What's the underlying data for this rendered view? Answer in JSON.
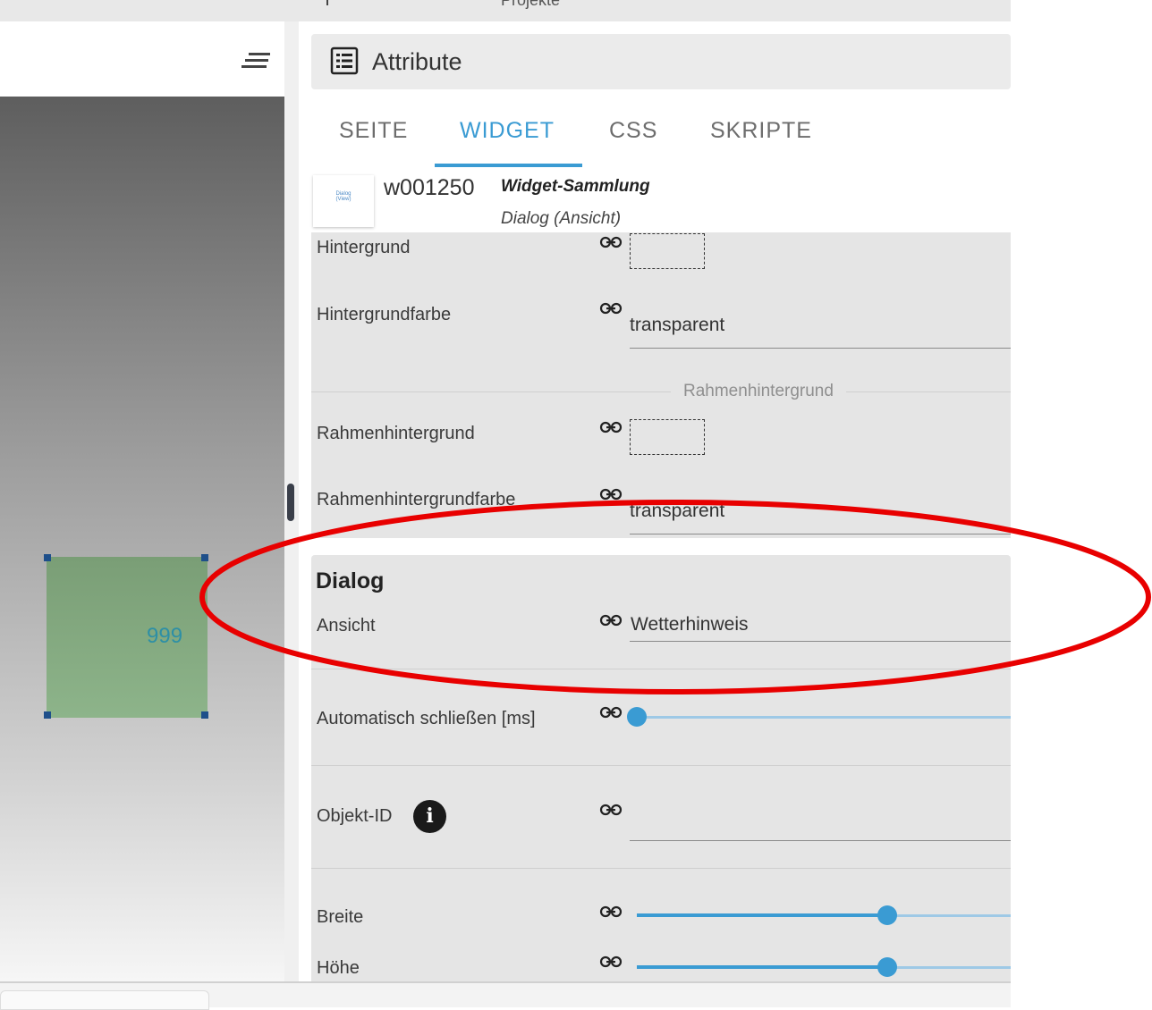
{
  "app": {
    "top_tab_cut": "Projekte"
  },
  "canvas": {
    "widget_value": "999",
    "widget_bg_color": "#8db48a",
    "widget_text_color": "#2d8fa6"
  },
  "panel": {
    "title": "Attribute",
    "tabs": [
      {
        "label": "SEITE",
        "active": false
      },
      {
        "label": "WIDGET",
        "active": true
      },
      {
        "label": "CSS",
        "active": false
      },
      {
        "label": "SKRIPTE",
        "active": false
      }
    ],
    "accent_color": "#3a9bd3",
    "widget": {
      "thumb_line1": "Dialog",
      "thumb_line2": "(View)",
      "id": "w001250",
      "set": "Widget-Sammlung",
      "type": "Dialog (Ansicht)"
    },
    "rows": {
      "hintergrund": {
        "label": "Hintergrund"
      },
      "hintergrundfarbe": {
        "label": "Hintergrundfarbe",
        "value": "transparent"
      },
      "rahmen_divider": "Rahmenhintergrund",
      "rahmenhintergrund": {
        "label": "Rahmenhintergrund"
      },
      "rahmenhintergrundfarbe": {
        "label": "Rahmenhintergrundfarbe",
        "value": "transparent"
      }
    },
    "dialog": {
      "section_title": "Dialog",
      "ansicht": {
        "label": "Ansicht",
        "value": "Wetterhinweis"
      },
      "auto_close": {
        "label": "Automatisch schließen [ms]",
        "value": 0
      },
      "objekt_id": {
        "label": "Objekt-ID",
        "value": ""
      },
      "breite": {
        "label": "Breite"
      },
      "hoehe": {
        "label": "Höhe"
      }
    }
  },
  "annotation": {
    "highlight_color": "#e80000"
  }
}
